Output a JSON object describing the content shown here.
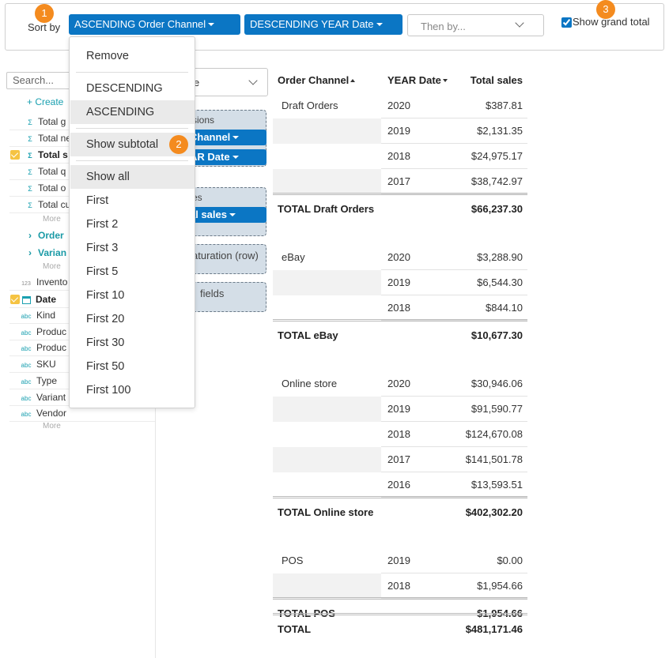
{
  "sort_bar": {
    "label": "Sort by",
    "chips": [
      "ASCENDING Order Channel",
      "DESCENDING YEAR Date"
    ],
    "then_by_placeholder": "Then by...",
    "show_grand_total_label": "Show grand total",
    "show_grand_total_checked": true
  },
  "badges": [
    "1",
    "2",
    "3"
  ],
  "sidebar": {
    "search_placeholder": "Search...",
    "create_label": "+ Create",
    "more_label": "More",
    "fields": [
      {
        "icon": "Σ",
        "label": "Total g",
        "checked": false,
        "style": "normal"
      },
      {
        "icon": "Σ",
        "label": "Total ne",
        "checked": false,
        "style": "normal"
      },
      {
        "icon": "Σ",
        "label": "Total s",
        "checked": true,
        "style": "bold"
      },
      {
        "icon": "Σ",
        "label": "Total q",
        "checked": false,
        "style": "normal"
      },
      {
        "icon": "Σ",
        "label": "Total o",
        "checked": false,
        "style": "normal"
      },
      {
        "icon": "Σ",
        "label": "Total cu",
        "checked": false,
        "style": "normal"
      }
    ],
    "groups": [
      {
        "label": "Order"
      },
      {
        "label": "Varian"
      }
    ],
    "inventory_label": "Invento",
    "inventory_icon": "123",
    "date_label": "Date",
    "abc_icon": "abc",
    "attrs": [
      "Kind",
      "Produc",
      "Produc",
      "SKU",
      "Type",
      "Variant",
      "Vendor"
    ]
  },
  "layout_panel": {
    "type_select_text": "e",
    "dimensions_title": "sions",
    "dim_chips": [
      "Channel",
      "AR Date"
    ],
    "measures_title": "es",
    "measure_chips": [
      "al sales"
    ],
    "saturation_label": "aturation (row)",
    "fields_label": "fields"
  },
  "menu": {
    "items": [
      {
        "label": "Remove",
        "highlight": false
      },
      {
        "label": "DESCENDING",
        "highlight": false
      },
      {
        "label": "ASCENDING",
        "highlight": true
      },
      {
        "label": "Show subtotal",
        "highlight": true
      },
      {
        "label": "Show all",
        "highlight": true
      },
      {
        "label": "First",
        "highlight": false
      },
      {
        "label": "First 2",
        "highlight": false
      },
      {
        "label": "First 3",
        "highlight": false
      },
      {
        "label": "First 5",
        "highlight": false
      },
      {
        "label": "First 10",
        "highlight": false
      },
      {
        "label": "First 20",
        "highlight": false
      },
      {
        "label": "First 30",
        "highlight": false
      },
      {
        "label": "First 50",
        "highlight": false
      },
      {
        "label": "First 100",
        "highlight": false
      }
    ]
  },
  "pivot": {
    "headers": [
      "Order Channel",
      "YEAR Date",
      "Total sales"
    ],
    "groups": [
      {
        "channel": "Draft Orders",
        "rows": [
          {
            "year": "2020",
            "value": "$387.81"
          },
          {
            "year": "2019",
            "value": "$2,131.35"
          },
          {
            "year": "2018",
            "value": "$24,975.17"
          },
          {
            "year": "2017",
            "value": "$38,742.97"
          }
        ],
        "total_label": "TOTAL Draft Orders",
        "total_value": "$66,237.30"
      },
      {
        "channel": "eBay",
        "rows": [
          {
            "year": "2020",
            "value": "$3,288.90"
          },
          {
            "year": "2019",
            "value": "$6,544.30"
          },
          {
            "year": "2018",
            "value": "$844.10"
          }
        ],
        "total_label": "TOTAL eBay",
        "total_value": "$10,677.30"
      },
      {
        "channel": "Online store",
        "rows": [
          {
            "year": "2020",
            "value": "$30,946.06"
          },
          {
            "year": "2019",
            "value": "$91,590.77"
          },
          {
            "year": "2018",
            "value": "$124,670.08"
          },
          {
            "year": "2017",
            "value": "$141,501.78"
          },
          {
            "year": "2016",
            "value": "$13,593.51"
          }
        ],
        "total_label": "TOTAL Online store",
        "total_value": "$402,302.20"
      },
      {
        "channel": "POS",
        "rows": [
          {
            "year": "2019",
            "value": "$0.00"
          },
          {
            "year": "2018",
            "value": "$1,954.66"
          }
        ],
        "total_label": "TOTAL POS",
        "total_value": "$1,954.66"
      }
    ],
    "grand_total_label": "TOTAL",
    "grand_total_value": "$481,171.46"
  },
  "colors": {
    "accent": "#0b76c4",
    "badge": "#f48b1f",
    "teal": "#1aa0b0",
    "zone_bg": "#d4dee7"
  }
}
